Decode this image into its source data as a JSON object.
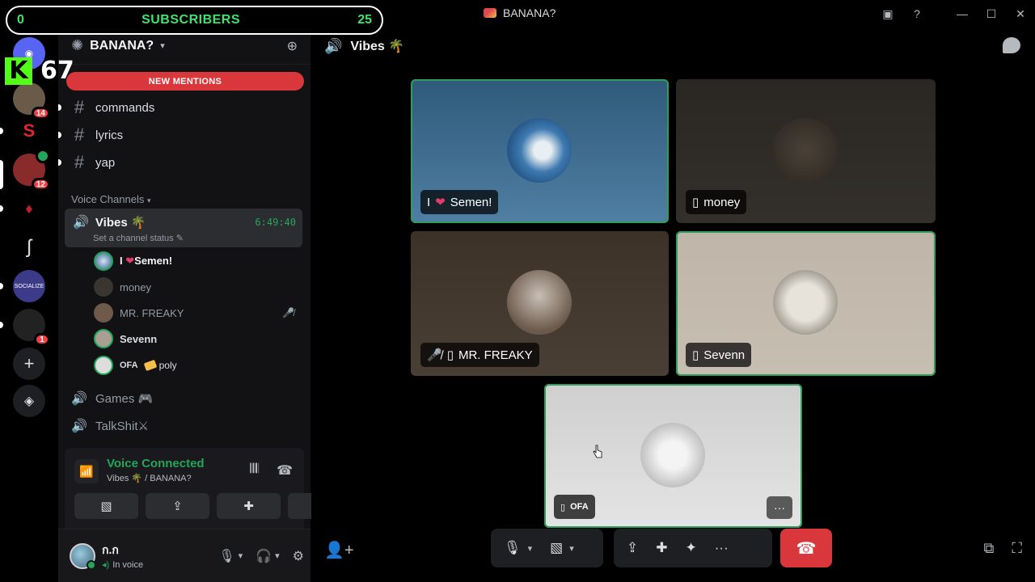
{
  "window": {
    "title": "BANANA?",
    "controls": [
      "inbox-icon",
      "help-icon",
      "minimize-icon",
      "maximize-icon",
      "close-icon"
    ]
  },
  "overlay": {
    "sub_left": "0",
    "sub_label": "SUBSCRIBERS",
    "sub_right": "25",
    "kick_letter": "K",
    "kick_count": "67"
  },
  "rail": {
    "badges": [
      "14",
      "12",
      "1"
    ],
    "socialize_label": "SOCIALIZE"
  },
  "guild": {
    "name": "BANANA?",
    "new_mentions": "NEW MENTIONS",
    "text_channels": [
      "commands",
      "lyrics",
      "yap"
    ],
    "voice_category": "Voice Channels",
    "active_voice": {
      "name": "Vibes 🌴",
      "timer": "6:49:40",
      "status": "Set a channel status"
    },
    "members": [
      {
        "name": "I ❤️ Semen!",
        "name_plain": "I",
        "heart": "❤",
        "name_tail": "Semen!"
      },
      {
        "name": "money"
      },
      {
        "name": "MR. FREAKY"
      },
      {
        "name": "Sevenn"
      },
      {
        "name": "OFA",
        "activity": "poly"
      }
    ],
    "other_voice": [
      "Games 🎮",
      "TalkShit⚔"
    ]
  },
  "voice_panel": {
    "title": "Voice Connected",
    "subtitle": "Vibes 🌴 / BANANA?"
  },
  "user": {
    "name": "ก.ก",
    "status": "In voice"
  },
  "main": {
    "channel_name": "Vibes 🌴",
    "tiles": {
      "semen": {
        "label_pre": "I",
        "heart": "❤",
        "label_post": "Semen!"
      },
      "money": {
        "label": "money"
      },
      "freaky": {
        "label": "MR. FREAKY"
      },
      "sevenn": {
        "label": "Sevenn"
      },
      "ofa": {
        "label": "OFA",
        "more": "···"
      }
    }
  },
  "colors": {
    "accent_green": "#23a55a",
    "danger_red": "#da373c",
    "overlay_green": "#3fe26a",
    "kick_green": "#53fc18"
  }
}
